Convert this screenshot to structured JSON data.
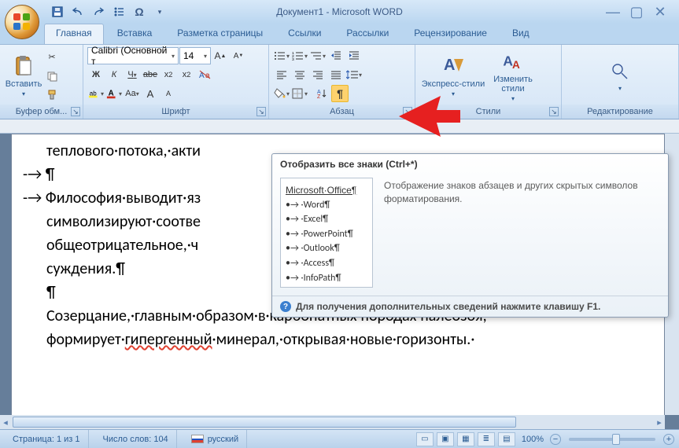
{
  "title": "Документ1 - Microsoft WORD",
  "qat": {
    "save": "save",
    "undo": "undo",
    "redo": "redo",
    "bullet": "bullet",
    "omega": "Ω",
    "more": "▾"
  },
  "win": {
    "min": "—",
    "max": "▢",
    "close": "✕"
  },
  "tabs": [
    "Главная",
    "Вставка",
    "Разметка страницы",
    "Ссылки",
    "Рассылки",
    "Рецензирование",
    "Вид"
  ],
  "groups": {
    "clipboard": {
      "label": "Буфер обм...",
      "paste": "Вставить"
    },
    "font": {
      "label": "Шрифт",
      "name": "Calibri (Основной т",
      "size": "14"
    },
    "para": {
      "label": "Абзац"
    },
    "styles": {
      "label": "Стили",
      "quick": "Экспресс-стили",
      "change": "Изменить стили"
    },
    "editing": {
      "label": "Редактирование"
    }
  },
  "tooltip": {
    "title": "Отобразить все знаки (Ctrl+*)",
    "desc": "Отображение знаков абзацев и других скрытых символов форматирования.",
    "footer": "Для получения дополнительных сведений нажмите клавишу F1.",
    "preview_title": "Microsoft·Office¶",
    "preview_items": [
      "•→ ·Word¶",
      "•→ ·Excel¶",
      "•→ ·PowerPoint¶",
      "•→ ·Outlook¶",
      "•→ ·Access¶",
      "•→ ·InfoPath¶"
    ]
  },
  "doc": {
    "l1": "теплового·потока,·акти",
    "l2a": "-→ ¶",
    "l2b": "-→ Философия·выводит·яз",
    "l3": "символизируют·соотве",
    "l4": "общеотрицательное,·ч",
    "l5": "суждения.¶",
    "l6": "¶",
    "l7": "Созерцание,·главным·образом·в·карбонатных·породах·палеозоя,·",
    "l8": "формирует·",
    "l8b": "гипергенный",
    "l8c": "·минерал,·открывая·новые·горизонты.·"
  },
  "status": {
    "page": "Страница: 1 из 1",
    "words": "Число слов: 104",
    "lang": "русский",
    "zoom": "100%"
  }
}
